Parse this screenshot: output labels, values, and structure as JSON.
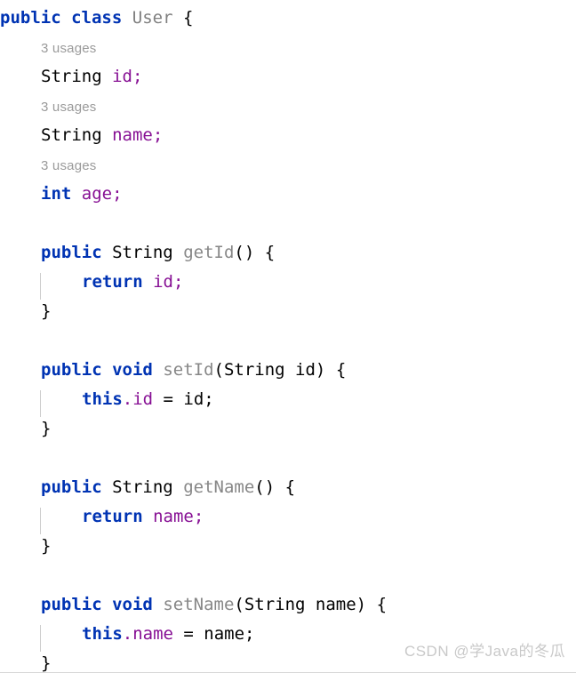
{
  "editor": {
    "background_color": "#ffffff",
    "font_size_px": 19,
    "line_height_px": 33,
    "theme": "IntelliJ Light"
  },
  "colors": {
    "keyword": "#0033B3",
    "field": "#871094",
    "method_declaration": "#878787",
    "class_name": "#808080",
    "default_text": "#000000",
    "inlay_hint": "#9a9a9a",
    "indent_guide": "#cdcdcd",
    "watermark": "#c9c9c9"
  },
  "code": {
    "class_declaration": {
      "keyword_public": "public",
      "keyword_class": "class",
      "class_name": "User",
      "brace_open": "{"
    },
    "fields": [
      {
        "usages_hint": "3 usages",
        "type": "String",
        "name": "id",
        "semicolon": ";"
      },
      {
        "usages_hint": "3 usages",
        "type": "String",
        "name": "name",
        "semicolon": ";"
      },
      {
        "usages_hint": "3 usages",
        "type": "int",
        "name": "age",
        "semicolon": ";"
      }
    ],
    "methods": [
      {
        "modifier": "public",
        "return_type": "String",
        "name": "getId",
        "params": "()",
        "brace_open": "{",
        "body_keyword": "return",
        "body_field": "id",
        "body_semicolon": ";",
        "brace_close": "}"
      },
      {
        "modifier": "public",
        "return_type": "void",
        "name": "setId",
        "params": "(String id)",
        "brace_open": "{",
        "body_keyword": "this",
        "body_field": ".id",
        "body_assign": " = id;",
        "brace_close": "}"
      },
      {
        "modifier": "public",
        "return_type": "String",
        "name": "getName",
        "params": "()",
        "brace_open": "{",
        "body_keyword": "return",
        "body_field": "name",
        "body_semicolon": ";",
        "brace_close": "}"
      },
      {
        "modifier": "public",
        "return_type": "void",
        "name": "setName",
        "params": "(String name)",
        "brace_open": "{",
        "body_keyword": "this",
        "body_field": ".name",
        "body_assign": " = name;",
        "brace_close": "}"
      }
    ]
  },
  "watermark": {
    "text": "CSDN @学Java的冬瓜"
  }
}
